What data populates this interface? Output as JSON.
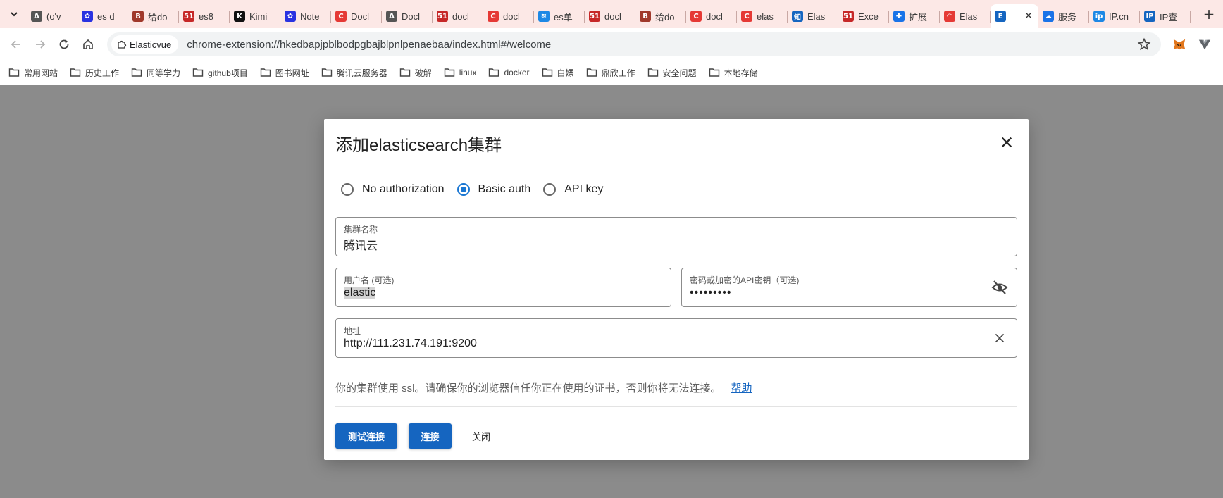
{
  "browser": {
    "tabs": [
      {
        "title": "(o'v",
        "icon": "ai-icon",
        "color": "#555555",
        "glyph": "ᐃ"
      },
      {
        "title": "es d",
        "icon": "baidu-paw-icon",
        "color": "#2932e1",
        "glyph": "✿"
      },
      {
        "title": "给do",
        "icon": "b-icon",
        "color": "#a0392b",
        "glyph": "B"
      },
      {
        "title": "es8",
        "icon": "51cto-icon",
        "color": "#c62828",
        "glyph": "51"
      },
      {
        "title": "Kimi",
        "icon": "kimi-icon",
        "color": "#111111",
        "glyph": "K"
      },
      {
        "title": "Note",
        "icon": "baidu-paw-icon",
        "color": "#2932e1",
        "glyph": "✿"
      },
      {
        "title": "Docl",
        "icon": "csdn-icon",
        "color": "#e53935",
        "glyph": "C"
      },
      {
        "title": "Docl",
        "icon": "ai-icon",
        "color": "#555555",
        "glyph": "ᐃ"
      },
      {
        "title": "docl",
        "icon": "51cto-icon",
        "color": "#c62828",
        "glyph": "51"
      },
      {
        "title": "docl",
        "icon": "csdn-icon",
        "color": "#e53935",
        "glyph": "C"
      },
      {
        "title": "es单",
        "icon": "layers-icon",
        "color": "#1e88e5",
        "glyph": "≋"
      },
      {
        "title": "docl",
        "icon": "51cto-icon",
        "color": "#c62828",
        "glyph": "51"
      },
      {
        "title": "给do",
        "icon": "b-icon",
        "color": "#a0392b",
        "glyph": "B"
      },
      {
        "title": "docl",
        "icon": "csdn-icon",
        "color": "#e53935",
        "glyph": "C"
      },
      {
        "title": "elas",
        "icon": "csdn-icon",
        "color": "#e53935",
        "glyph": "C"
      },
      {
        "title": "Elas",
        "icon": "zhihu-icon",
        "color": "#1565c0",
        "glyph": "知"
      },
      {
        "title": "Exce",
        "icon": "51cto-icon",
        "color": "#c62828",
        "glyph": "51"
      },
      {
        "title": "扩展",
        "icon": "puzzle-icon",
        "color": "#1a73e8",
        "glyph": "✚"
      },
      {
        "title": "Elas",
        "icon": "rainbow-icon",
        "color": "#e53935",
        "glyph": "◠"
      }
    ],
    "active_tab": {
      "title": "",
      "icon": "extension-icon",
      "color": "#1565c0",
      "glyph": "E"
    },
    "tabs_after": [
      {
        "title": "服务",
        "icon": "cloud-icon",
        "color": "#1a73e8",
        "glyph": "☁"
      },
      {
        "title": "IP.cn",
        "icon": "ipcn-icon",
        "color": "#1e88e5",
        "glyph": "ip"
      },
      {
        "title": "IP查",
        "icon": "ip-icon",
        "color": "#1565c0",
        "glyph": "IP"
      }
    ],
    "site_chip": "Elasticvue",
    "url": "chrome-extension://hkedbapjpblbodpgbajblpnlpenaebaa/index.html#/welcome",
    "bookmarks": [
      "常用网站",
      "历史工作",
      "同等学力",
      "github项目",
      "图书网址",
      "腾讯云服务器",
      "破解",
      "linux",
      "docker",
      "白嫖",
      "鼎欣工作",
      "安全问题",
      "本地存储"
    ]
  },
  "dialog": {
    "title": "添加elasticsearch集群",
    "auth_options": [
      "No authorization",
      "Basic auth",
      "API key"
    ],
    "auth_selected": "Basic auth",
    "cluster_name": {
      "label": "集群名称",
      "value": "腾讯云"
    },
    "username": {
      "label": "用户名 (可选)",
      "value": "elastic"
    },
    "password": {
      "label": "密码或加密的API密钥（可选)",
      "value": "•••••••••"
    },
    "address": {
      "label": "地址",
      "value": "http://111.231.74.191:9200"
    },
    "ssl_note": "你的集群使用 ssl。请确保你的浏览器信任你正在使用的证书，否则你将无法连接。",
    "help_link": "帮助",
    "buttons": {
      "test": "测试连接",
      "connect": "连接",
      "close": "关闭"
    }
  },
  "colors": {
    "accent": "#1565c0",
    "tabstrip_bg": "#fce8e6",
    "overlay_bg": "#8b8b8b"
  }
}
